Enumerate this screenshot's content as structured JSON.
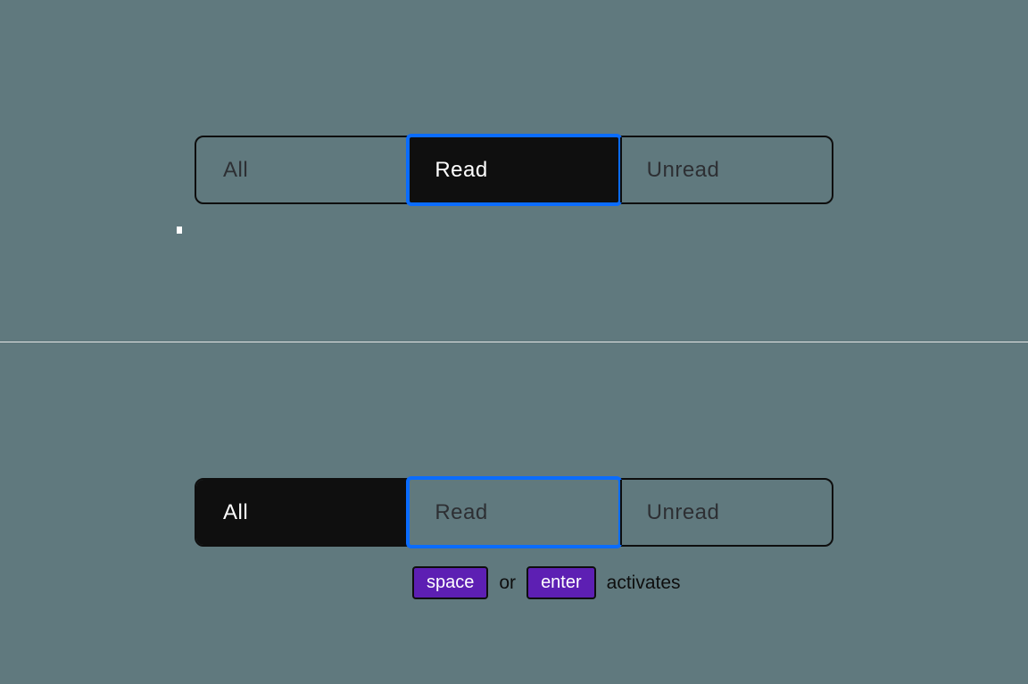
{
  "example_top": {
    "segments": [
      {
        "label": "All",
        "selected": false,
        "focused": false
      },
      {
        "label": "Read",
        "selected": true,
        "focused": true
      },
      {
        "label": "Unread",
        "selected": false,
        "focused": false
      }
    ]
  },
  "example_bottom": {
    "segments": [
      {
        "label": "All",
        "selected": true,
        "focused": false
      },
      {
        "label": "Read",
        "selected": false,
        "focused": true
      },
      {
        "label": "Unread",
        "selected": false,
        "focused": false
      }
    ]
  },
  "hint": {
    "key_space": "space",
    "or": "or",
    "key_enter": "enter",
    "activates": "activates"
  }
}
